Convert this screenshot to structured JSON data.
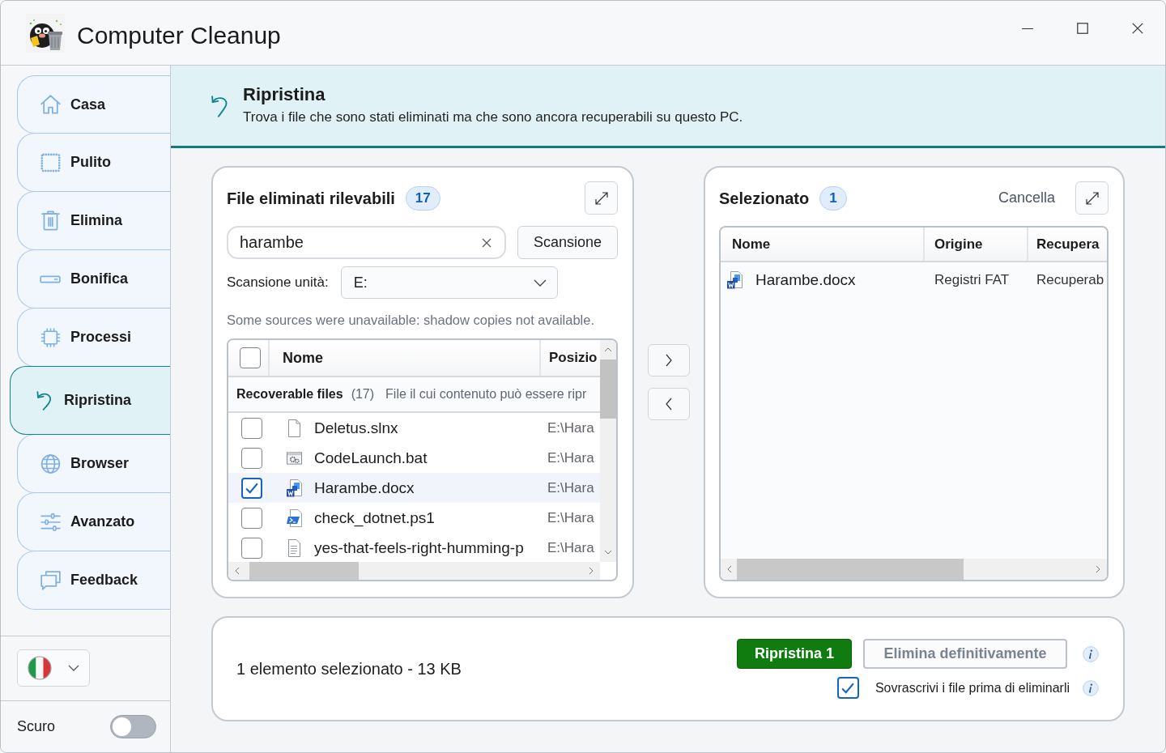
{
  "window": {
    "title": "Computer Cleanup"
  },
  "sidebar": {
    "items": [
      {
        "label": "Casa",
        "selected": false
      },
      {
        "label": "Pulito",
        "selected": false
      },
      {
        "label": "Elimina",
        "selected": false
      },
      {
        "label": "Bonifica",
        "selected": false
      },
      {
        "label": "Processi",
        "selected": false
      },
      {
        "label": "Ripristina",
        "selected": true
      },
      {
        "label": "Browser",
        "selected": false
      },
      {
        "label": "Avanzato",
        "selected": false
      },
      {
        "label": "Feedback",
        "selected": false
      }
    ],
    "dark_mode": {
      "label": "Scuro",
      "on": false
    }
  },
  "header": {
    "title": "Ripristina",
    "subtitle": "Trova i file che sono stati eliminati ma che sono ancora recuperabili su questo PC."
  },
  "found_panel": {
    "title": "File eliminati rilevabili",
    "count": "17",
    "search": {
      "value": "harambe"
    },
    "scan_button": "Scansione",
    "drive": {
      "label": "Scansione unità:",
      "value": "E:"
    },
    "notice": "Some sources were unavailable: shadow copies not available.",
    "table": {
      "all_checked": false,
      "columns": [
        "Nome",
        "Posizio"
      ],
      "group": {
        "title": "Recoverable files",
        "count": "(17)",
        "description": "File il cui contenuto può essere ripr"
      },
      "rows": [
        {
          "kind": "blank",
          "name": "Deletus.slnx",
          "location": "E:\\Hara",
          "checked": false
        },
        {
          "kind": "settings",
          "name": "CodeLaunch.bat",
          "location": "E:\\Hara",
          "checked": false
        },
        {
          "kind": "word",
          "name": "Harambe.docx",
          "location": "E:\\Hara",
          "checked": true
        },
        {
          "kind": "script",
          "name": "check_dotnet.ps1",
          "location": "E:\\Hara",
          "checked": false
        },
        {
          "kind": "text",
          "name": "yes-that-feels-right-humming-p",
          "location": "E:\\Hara",
          "checked": false
        }
      ]
    }
  },
  "selected_panel": {
    "title": "Selezionato",
    "count": "1",
    "clear_button": "Cancella",
    "table": {
      "columns": [
        "Nome",
        "Origine",
        "Recupera"
      ],
      "rows": [
        {
          "kind": "word",
          "name": "Harambe.docx",
          "origin": "Registri FAT",
          "status": "Recuperab"
        }
      ]
    }
  },
  "footer": {
    "summary": "1 elemento selezionato - 13 KB",
    "restore_button": "Ripristina 1",
    "delete_button": {
      "label": "Elimina definitivamente",
      "disabled": true
    },
    "overwrite": {
      "label": "Sovrascrivi i file prima di eliminarli",
      "checked": true
    }
  }
}
